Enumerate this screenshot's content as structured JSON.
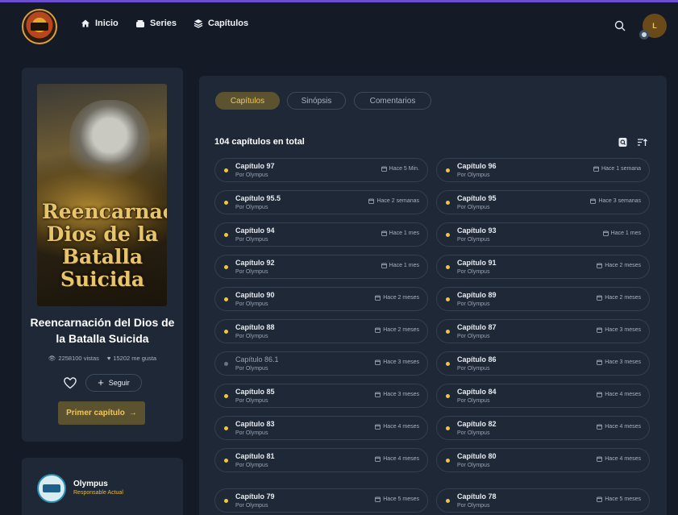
{
  "nav": {
    "home": "Inicio",
    "series": "Series",
    "chapters": "Capítulos",
    "avatar_initial": "L"
  },
  "manga": {
    "cover_title_art": "Reencarnación Dios de la Batalla Suicida",
    "title": "Reencarnación del Dios de la Batalla Suicida",
    "views": "2258100 vistas",
    "likes": "15202 me gusta",
    "follow_label": "Seguir",
    "first_chapter_label": "Primer capítulo"
  },
  "group": {
    "name": "Olympus",
    "role": "Responsable Actual"
  },
  "tabs": [
    {
      "label": "Capítulos",
      "active": true
    },
    {
      "label": "Sinópsis",
      "active": false
    },
    {
      "label": "Comentarios",
      "active": false
    }
  ],
  "chapters_total": "104 capítulos en total",
  "chapters": [
    {
      "name": "Capítulo 97",
      "by": "Por Olympus",
      "time": "Hace 5 Min.",
      "read": false
    },
    {
      "name": "Capítulo 96",
      "by": "Por Olympus",
      "time": "Hace 1 semana",
      "read": false
    },
    {
      "name": "Capítulo 95.5",
      "by": "Por Olympus",
      "time": "Hace 2 semanas",
      "read": false
    },
    {
      "name": "Capítulo 95",
      "by": "Por Olympus",
      "time": "Hace 3 semanas",
      "read": false
    },
    {
      "name": "Capítulo 94",
      "by": "Por Olympus",
      "time": "Hace 1 mes",
      "read": false
    },
    {
      "name": "Capítulo 93",
      "by": "Por Olympus",
      "time": "Hace 1 mes",
      "read": false
    },
    {
      "name": "Capítulo 92",
      "by": "Por Olympus",
      "time": "Hace 1 mes",
      "read": false
    },
    {
      "name": "Capítulo 91",
      "by": "Por Olympus",
      "time": "Hace 2 meses",
      "read": false
    },
    {
      "name": "Capítulo 90",
      "by": "Por Olympus",
      "time": "Hace 2 meses",
      "read": false
    },
    {
      "name": "Capítulo 89",
      "by": "Por Olympus",
      "time": "Hace 2 meses",
      "read": false
    },
    {
      "name": "Capítulo 88",
      "by": "Por Olympus",
      "time": "Hace 2 meses",
      "read": false
    },
    {
      "name": "Capítulo 87",
      "by": "Por Olympus",
      "time": "Hace 3 meses",
      "read": false
    },
    {
      "name": "Capítulo 86.1",
      "by": "Por Olympus",
      "time": "Hace 3 meses",
      "read": true
    },
    {
      "name": "Capítulo 86",
      "by": "Por Olympus",
      "time": "Hace 3 meses",
      "read": false
    },
    {
      "name": "Capítulo 85",
      "by": "Por Olympus",
      "time": "Hace 3 meses",
      "read": false
    },
    {
      "name": "Capítulo 84",
      "by": "Por Olympus",
      "time": "Hace 4 meses",
      "read": false
    },
    {
      "name": "Capítulo 83",
      "by": "Por Olympus",
      "time": "Hace 4 meses",
      "read": false
    },
    {
      "name": "Capítulo 82",
      "by": "Por Olympus",
      "time": "Hace 4 meses",
      "read": false
    },
    {
      "name": "Capítulo 81",
      "by": "Por Olympus",
      "time": "Hace 4 meses",
      "read": false
    },
    {
      "name": "Capítulo 80",
      "by": "Por Olympus",
      "time": "Hace 4 meses",
      "read": false
    },
    {
      "name": "Capítulo 79",
      "by": "Por Olympus",
      "time": "Hace 5 meses",
      "read": false
    },
    {
      "name": "Capítulo 78",
      "by": "Por Olympus",
      "time": "Hace 5 meses",
      "read": false
    }
  ],
  "colors": {
    "background": "#141b27",
    "card": "#1e2837",
    "accent": "#f2c55c",
    "accent_bg": "#5b5330"
  }
}
